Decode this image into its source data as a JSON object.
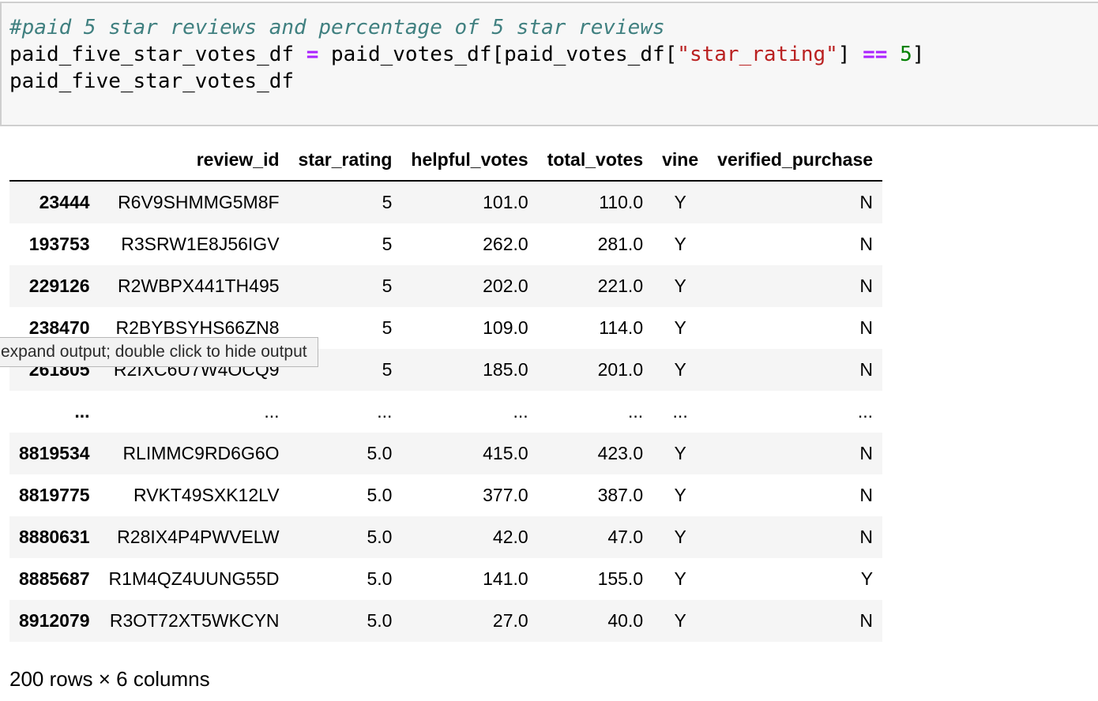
{
  "code": {
    "comment": "#paid 5 star reviews and percentage of 5 star reviews",
    "line2": {
      "lhs": "paid_five_star_votes_df ",
      "assign": "=",
      "mid": " paid_votes_df[paid_votes_df[",
      "string": "\"star_rating\"",
      "close": "] ",
      "eq": "==",
      "space": " ",
      "num": "5",
      "end": "]"
    },
    "line3": "paid_five_star_votes_df"
  },
  "table": {
    "columns": [
      "",
      "review_id",
      "star_rating",
      "helpful_votes",
      "total_votes",
      "vine",
      "verified_purchase"
    ],
    "rows": [
      {
        "index": "23444",
        "review_id": "R6V9SHMMG5M8F",
        "star_rating": "5",
        "helpful_votes": "101.0",
        "total_votes": "110.0",
        "vine": "Y",
        "verified_purchase": "N"
      },
      {
        "index": "193753",
        "review_id": "R3SRW1E8J56IGV",
        "star_rating": "5",
        "helpful_votes": "262.0",
        "total_votes": "281.0",
        "vine": "Y",
        "verified_purchase": "N"
      },
      {
        "index": "229126",
        "review_id": "R2WBPX441TH495",
        "star_rating": "5",
        "helpful_votes": "202.0",
        "total_votes": "221.0",
        "vine": "Y",
        "verified_purchase": "N"
      },
      {
        "index": "238470",
        "review_id": "R2BYBSYHS66ZN8",
        "star_rating": "5",
        "helpful_votes": "109.0",
        "total_votes": "114.0",
        "vine": "Y",
        "verified_purchase": "N"
      },
      {
        "index": "261805",
        "review_id": "R2IXC6U7W4OCQ9",
        "star_rating": "5",
        "helpful_votes": "185.0",
        "total_votes": "201.0",
        "vine": "Y",
        "verified_purchase": "N"
      },
      {
        "index": "...",
        "review_id": "...",
        "star_rating": "...",
        "helpful_votes": "...",
        "total_votes": "...",
        "vine": "...",
        "verified_purchase": "..."
      },
      {
        "index": "8819534",
        "review_id": "RLIMMC9RD6G6O",
        "star_rating": "5.0",
        "helpful_votes": "415.0",
        "total_votes": "423.0",
        "vine": "Y",
        "verified_purchase": "N"
      },
      {
        "index": "8819775",
        "review_id": "RVKT49SXK12LV",
        "star_rating": "5.0",
        "helpful_votes": "377.0",
        "total_votes": "387.0",
        "vine": "Y",
        "verified_purchase": "N"
      },
      {
        "index": "8880631",
        "review_id": "R28IX4P4PWVELW",
        "star_rating": "5.0",
        "helpful_votes": "42.0",
        "total_votes": "47.0",
        "vine": "Y",
        "verified_purchase": "N"
      },
      {
        "index": "8885687",
        "review_id": "R1M4QZ4UUNG55D",
        "star_rating": "5.0",
        "helpful_votes": "141.0",
        "total_votes": "155.0",
        "vine": "Y",
        "verified_purchase": "Y"
      },
      {
        "index": "8912079",
        "review_id": "R3OT72XT5WKCYN",
        "star_rating": "5.0",
        "helpful_votes": "27.0",
        "total_votes": "40.0",
        "vine": "Y",
        "verified_purchase": "N"
      }
    ]
  },
  "shape_note": "200 rows × 6 columns",
  "tooltip": "expand output; double click to hide output"
}
